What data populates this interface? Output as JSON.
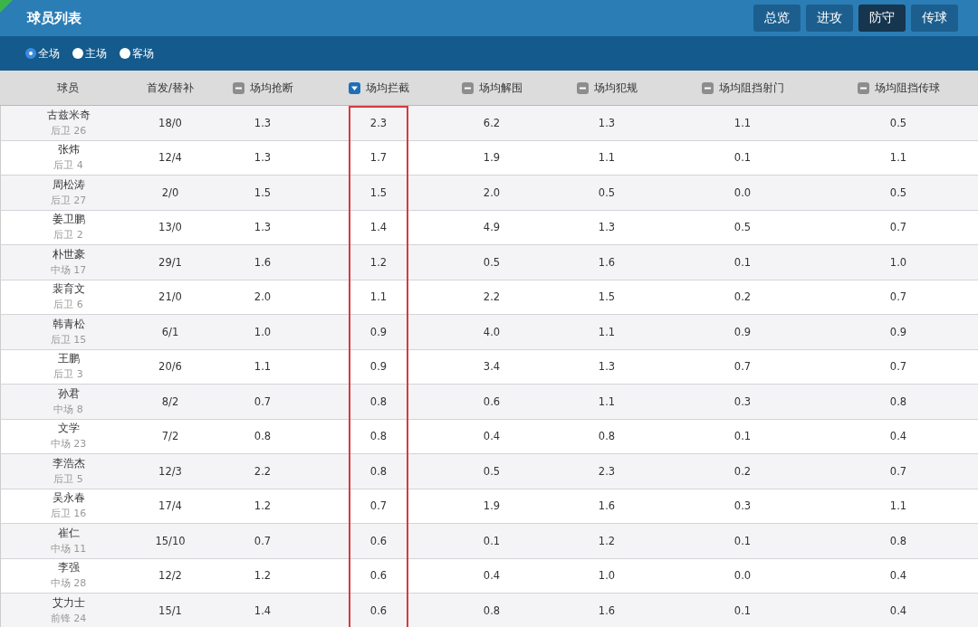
{
  "header": {
    "title": "球员列表",
    "tabs": [
      {
        "label": "总览",
        "selected": false
      },
      {
        "label": "进攻",
        "selected": false
      },
      {
        "label": "防守",
        "selected": true
      },
      {
        "label": "传球",
        "selected": false
      }
    ]
  },
  "filters": [
    {
      "label": "全场",
      "selected": true
    },
    {
      "label": "主场",
      "selected": false
    },
    {
      "label": "客场",
      "selected": false
    }
  ],
  "table": {
    "columns": [
      {
        "label": "球员",
        "kind": "plain",
        "highlighted": false
      },
      {
        "label": "首发/替补",
        "kind": "plain",
        "highlighted": false
      },
      {
        "label": "场均抢断",
        "kind": "sortable",
        "sorted": false,
        "highlighted": false
      },
      {
        "label": "场均拦截",
        "kind": "sortable",
        "sorted": true,
        "highlighted": true
      },
      {
        "label": "场均解围",
        "kind": "sortable",
        "sorted": false,
        "highlighted": false
      },
      {
        "label": "场均犯规",
        "kind": "sortable",
        "sorted": false,
        "highlighted": false
      },
      {
        "label": "场均阻挡射门",
        "kind": "sortable",
        "sorted": false,
        "highlighted": false
      },
      {
        "label": "场均阻挡传球",
        "kind": "sortable",
        "sorted": false,
        "highlighted": false
      }
    ],
    "rows": [
      {
        "cells": [
          {
            "player": "古兹米奇",
            "position": "后卫 26"
          },
          "18/0",
          "1.3",
          "2.3",
          "6.2",
          "1.3",
          "1.1",
          "0.5"
        ]
      },
      {
        "cells": [
          {
            "player": "张炜",
            "position": "后卫 4"
          },
          "12/4",
          "1.3",
          "1.7",
          "1.9",
          "1.1",
          "0.1",
          "1.1"
        ]
      },
      {
        "cells": [
          {
            "player": "周松涛",
            "position": "后卫 27"
          },
          "2/0",
          "1.5",
          "1.5",
          "2.0",
          "0.5",
          "0.0",
          "0.5"
        ]
      },
      {
        "cells": [
          {
            "player": "姜卫鹏",
            "position": "后卫 2"
          },
          "13/0",
          "1.3",
          "1.4",
          "4.9",
          "1.3",
          "0.5",
          "0.7"
        ]
      },
      {
        "cells": [
          {
            "player": "朴世豪",
            "position": "中场 17"
          },
          "29/1",
          "1.6",
          "1.2",
          "0.5",
          "1.6",
          "0.1",
          "1.0"
        ]
      },
      {
        "cells": [
          {
            "player": "裴育文",
            "position": "后卫 6"
          },
          "21/0",
          "2.0",
          "1.1",
          "2.2",
          "1.5",
          "0.2",
          "0.7"
        ]
      },
      {
        "cells": [
          {
            "player": "韩青松",
            "position": "后卫 15"
          },
          "6/1",
          "1.0",
          "0.9",
          "4.0",
          "1.1",
          "0.9",
          "0.9"
        ]
      },
      {
        "cells": [
          {
            "player": "王鹏",
            "position": "后卫 3"
          },
          "20/6",
          "1.1",
          "0.9",
          "3.4",
          "1.3",
          "0.7",
          "0.7"
        ]
      },
      {
        "cells": [
          {
            "player": "孙君",
            "position": "中场 8"
          },
          "8/2",
          "0.7",
          "0.8",
          "0.6",
          "1.1",
          "0.3",
          "0.8"
        ]
      },
      {
        "cells": [
          {
            "player": "文学",
            "position": "中场 23"
          },
          "7/2",
          "0.8",
          "0.8",
          "0.4",
          "0.8",
          "0.1",
          "0.4"
        ]
      },
      {
        "cells": [
          {
            "player": "李浩杰",
            "position": "后卫 5"
          },
          "12/3",
          "2.2",
          "0.8",
          "0.5",
          "2.3",
          "0.2",
          "0.7"
        ]
      },
      {
        "cells": [
          {
            "player": "吴永春",
            "position": "后卫 16"
          },
          "17/4",
          "1.2",
          "0.7",
          "1.9",
          "1.6",
          "0.3",
          "1.1"
        ]
      },
      {
        "cells": [
          {
            "player": "崔仁",
            "position": "中场 11"
          },
          "15/10",
          "0.7",
          "0.6",
          "0.1",
          "1.2",
          "0.1",
          "0.8"
        ]
      },
      {
        "cells": [
          {
            "player": "李强",
            "position": "中场 28"
          },
          "12/2",
          "1.2",
          "0.6",
          "0.4",
          "1.0",
          "0.0",
          "0.4"
        ]
      },
      {
        "cells": [
          {
            "player": "艾力士",
            "position": "前锋 24"
          },
          "15/1",
          "1.4",
          "0.6",
          "0.8",
          "1.6",
          "0.1",
          "0.4"
        ]
      }
    ]
  }
}
